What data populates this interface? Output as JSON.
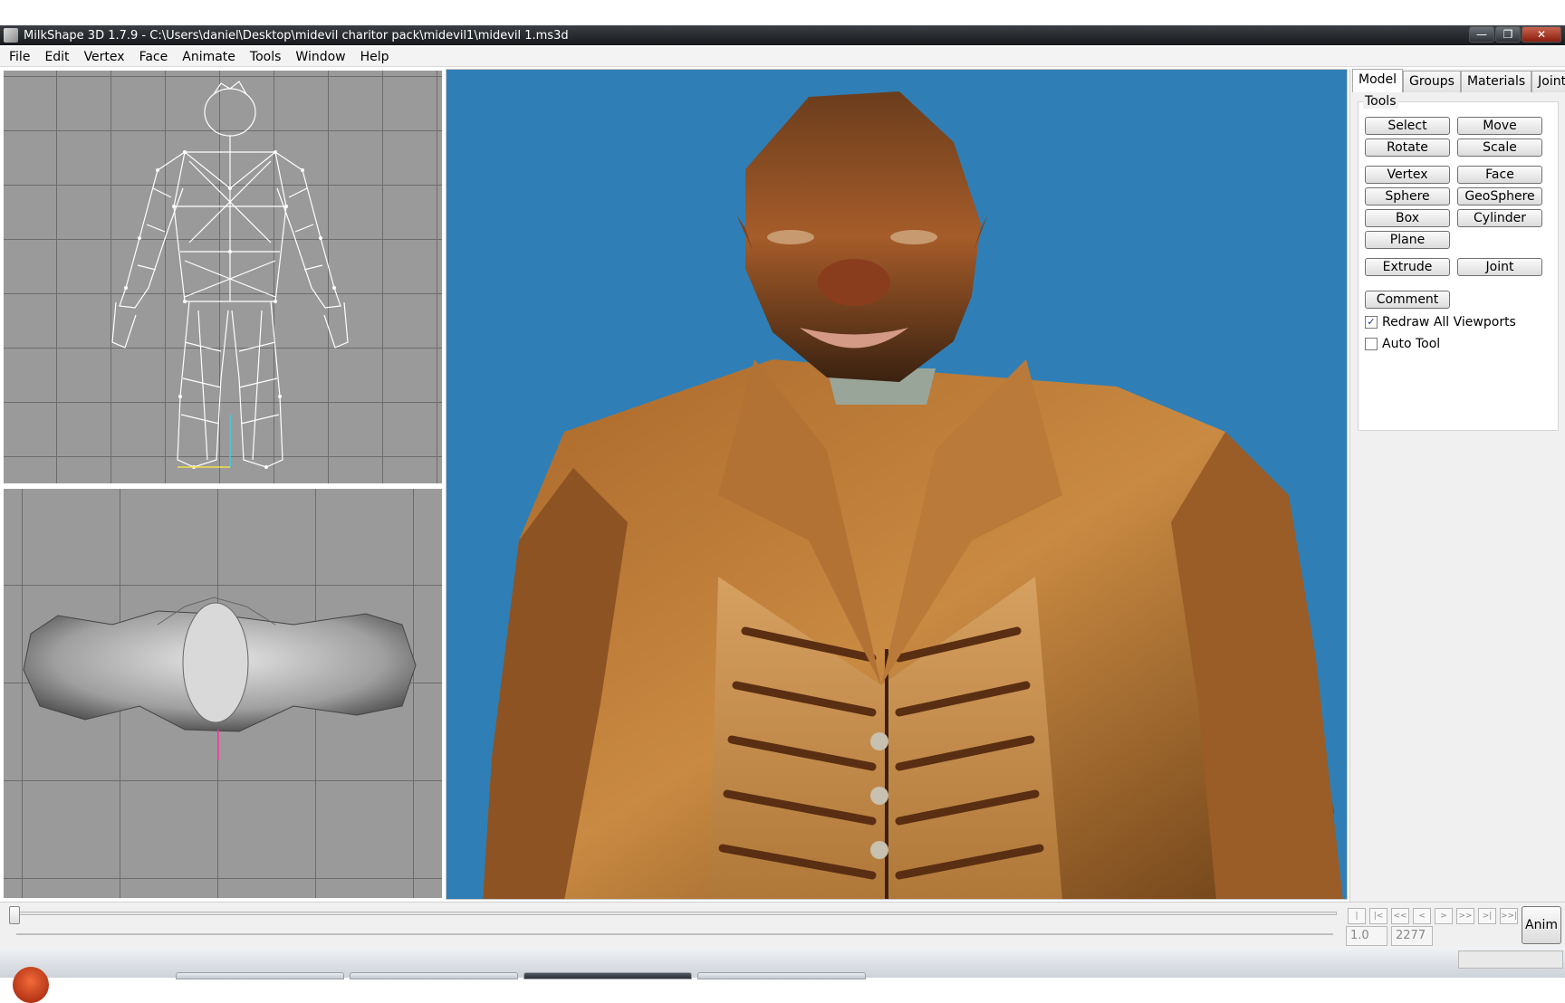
{
  "window": {
    "title": "MilkShape 3D 1.7.9 - C:\\Users\\daniel\\Desktop\\midevil charitor pack\\midevil1\\midevil 1.ms3d",
    "controls": {
      "minimize": "—",
      "maximize": "❐",
      "close": "✕"
    }
  },
  "menu": {
    "items": [
      "File",
      "Edit",
      "Vertex",
      "Face",
      "Animate",
      "Tools",
      "Window",
      "Help"
    ]
  },
  "viewports": {
    "front": {
      "mode": "wireframe",
      "icon": "wireframe-figure"
    },
    "top": {
      "mode": "shaded",
      "icon": "shaded-figure-top"
    },
    "main": {
      "mode": "textured",
      "background": "#2f7fb6"
    }
  },
  "panel": {
    "tabs": [
      "Model",
      "Groups",
      "Materials",
      "Joints"
    ],
    "active_tab": "Model",
    "group_label": "Tools",
    "buttons": {
      "select": "Select",
      "move": "Move",
      "rotate": "Rotate",
      "scale": "Scale",
      "vertex": "Vertex",
      "face": "Face",
      "sphere": "Sphere",
      "geosphere": "GeoSphere",
      "box": "Box",
      "cylinder": "Cylinder",
      "plane": "Plane",
      "extrude": "Extrude",
      "joint": "Joint",
      "comment": "Comment"
    },
    "checkboxes": {
      "redraw_all": {
        "label": "Redraw All Viewports",
        "checked": true,
        "mark": "✓"
      },
      "auto_tool": {
        "label": "Auto Tool",
        "checked": false,
        "mark": ""
      }
    }
  },
  "timeline": {
    "nav_buttons": [
      "|<<",
      "|<",
      "<<",
      "<",
      ">",
      ">>",
      ">|",
      ">>|"
    ],
    "current_frame": "1.0",
    "total_frames": "2277",
    "anim_label": "Anim"
  },
  "colors": {
    "main_viewport_bg": "#2f7fb6",
    "ortho_viewport_bg": "#9a9a9a",
    "grid_line": "#6c6c6c"
  }
}
